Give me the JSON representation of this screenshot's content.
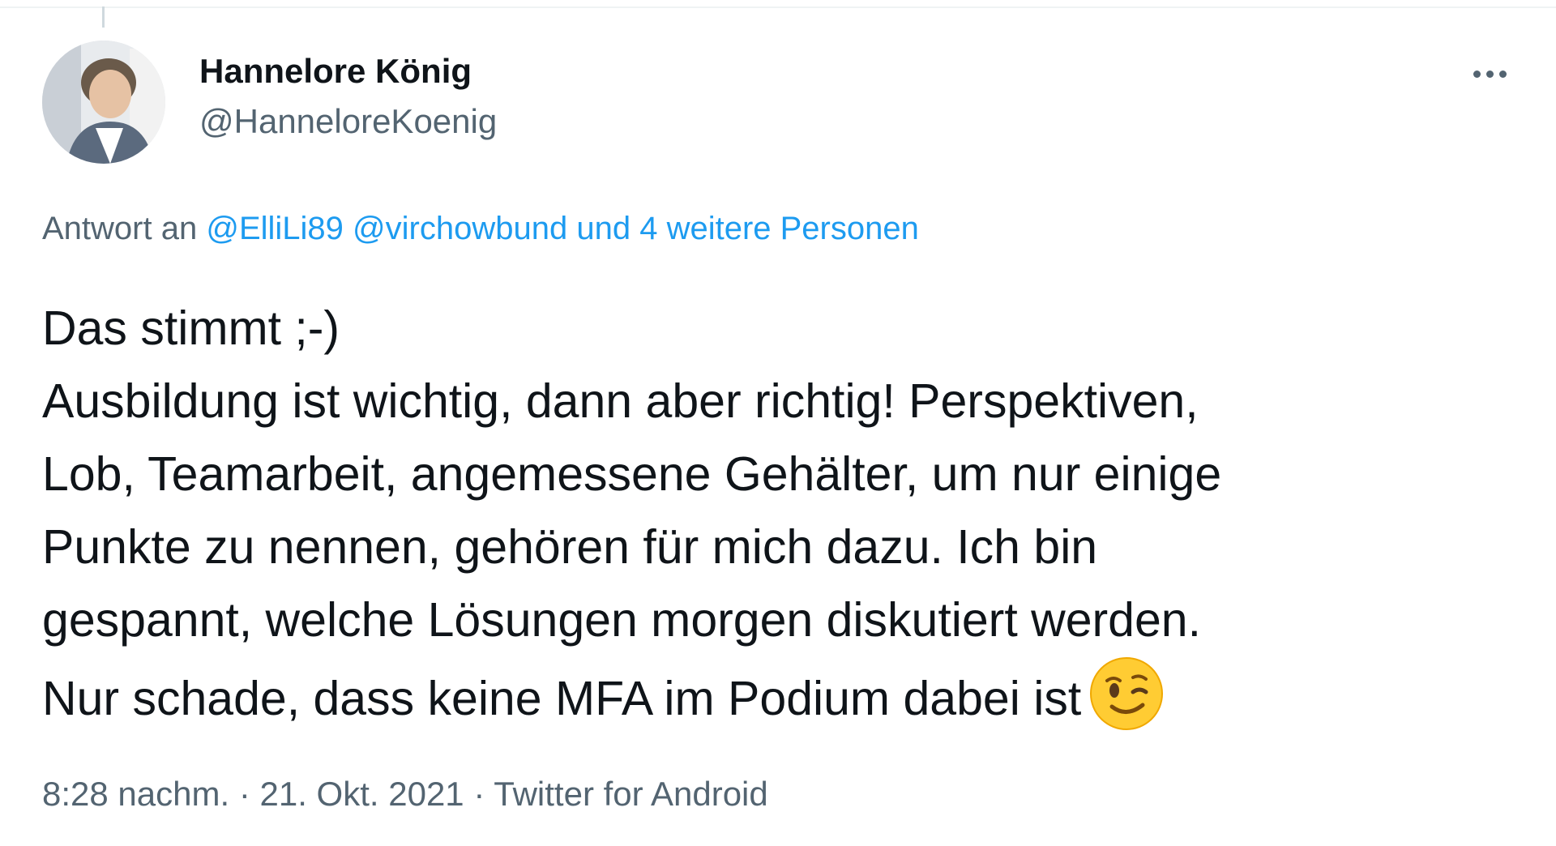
{
  "author": {
    "name": "Hannelore König",
    "handle": "@HanneloreKoenig"
  },
  "more_icon": "more-horizontal-icon",
  "reply": {
    "prefix": "Antwort an",
    "mentions": [
      "@ElliLi89",
      "@virchowbund"
    ],
    "others": "und 4 weitere Personen"
  },
  "tweet": {
    "lines": [
      "Das stimmt ;-)",
      "Ausbildung ist wichtig, dann aber richtig! Perspektiven,",
      "Lob, Teamarbeit, angemessene Gehälter, um nur einige",
      "Punkte zu nennen, gehören für mich dazu. Ich bin",
      "gespannt, welche Lösungen morgen diskutiert werden.",
      "Nur schade, dass keine MFA im Podium dabei ist"
    ],
    "emoji": "winking-face-emoji"
  },
  "meta": {
    "time": "8:28 nachm.",
    "separator": "·",
    "date": "21. Okt. 2021",
    "source": "Twitter for Android"
  },
  "colors": {
    "link": "#1d9bf0",
    "secondary_text": "#536471",
    "primary_text": "#0f1419"
  }
}
